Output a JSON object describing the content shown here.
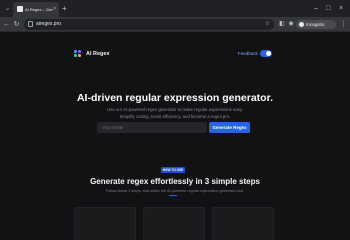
{
  "browser": {
    "tab_title": "AI Regex – Generate Regex Ea",
    "tab_close": "×",
    "new_tab": "+",
    "url": "airegex.pro",
    "incognito_label": "Incognito",
    "win_minimize": "–",
    "win_maximize": "□",
    "win_close": "×"
  },
  "header": {
    "logo_text": "AI Regex",
    "feedback": "Feedback",
    "logo_colors": [
      "#4f8bff",
      "#7c5cff",
      "#2ec4b6",
      "#ff9f43"
    ]
  },
  "hero": {
    "title": "AI-driven regular expression generator.",
    "subtitle_line1": "Use our AI-powered regex generator to make regular expressions easy.",
    "subtitle_line2": "Simplify coding, boost efficiency, and become a regex pro.",
    "email_placeholder": "Your email",
    "button_label": "Generate Regex"
  },
  "howto": {
    "badge": "HOW TO USE",
    "title": "Generate regex effortlessly in 3 simple steps",
    "subtitle": "Follow these 3 steps, and utilize the AI-powered regular expression generator tool."
  },
  "colors": {
    "accent": "#2563eb",
    "background": "#121214"
  }
}
